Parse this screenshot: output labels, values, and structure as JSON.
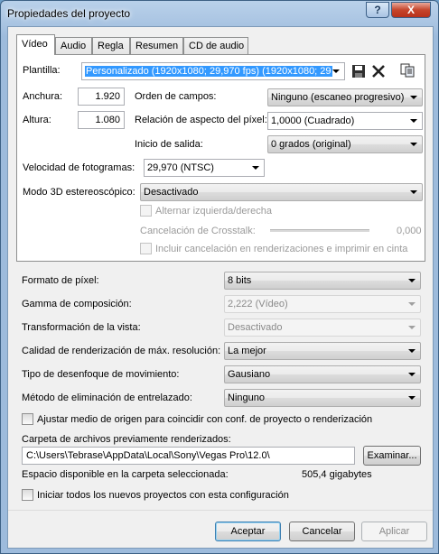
{
  "window": {
    "title": "Propiedades del proyecto",
    "help_label": "?",
    "close_label": "X"
  },
  "tabs": [
    {
      "label": "Vídeo",
      "active": true
    },
    {
      "label": "Audio"
    },
    {
      "label": "Regla"
    },
    {
      "label": "Resumen"
    },
    {
      "label": "CD de audio"
    }
  ],
  "video": {
    "template_label": "Plantilla:",
    "template_value": "Personalizado (1920x1080; 29,970 fps) (1920x1080; 29",
    "width_label": "Anchura:",
    "width_value": "1.920",
    "height_label": "Altura:",
    "height_value": "1.080",
    "field_order_label": "Orden de campos:",
    "field_order_value": "Ninguno (escaneo progresivo)",
    "pixel_aspect_label": "Relación de aspecto del píxel:",
    "pixel_aspect_value": "1,0000 (Cuadrado)",
    "output_rotation_label": "Inicio de salida:",
    "output_rotation_value": "0 grados (original)",
    "frame_rate_label": "Velocidad de fotogramas:",
    "frame_rate_value": "29,970 (NTSC)",
    "stereo3d_label": "Modo 3D estereoscópico:",
    "stereo3d_value": "Desactivado",
    "swap_lr_label": "Alternar izquierda/derecha",
    "crosstalk_label": "Cancelación de Crosstalk:",
    "crosstalk_value": "0,000",
    "include_crosstalk_label": "Incluir cancelación en renderizaciones e imprimir en cinta"
  },
  "settings": {
    "pixel_format_label": "Formato de píxel:",
    "pixel_format_value": "8 bits",
    "compositing_gamma_label": "Gamma de composición:",
    "compositing_gamma_value": "2,222 (Vídeo)",
    "view_transform_label": "Transformación de la vista:",
    "view_transform_value": "Desactivado",
    "render_quality_label": "Calidad de renderización de máx. resolución:",
    "render_quality_value": "La mejor",
    "motion_blur_label": "Tipo de desenfoque de movimiento:",
    "motion_blur_value": "Gausiano",
    "deinterlace_label": "Método de eliminación de entrelazado:",
    "deinterlace_value": "Ninguno",
    "adjust_source_label": "Ajustar medio de origen para coincidir con conf. de proyecto o renderización",
    "prerender_folder_label": "Carpeta de archivos previamente renderizados:",
    "prerender_folder_value": "C:\\Users\\Tebrase\\AppData\\Local\\Sony\\Vegas Pro\\12.0\\",
    "browse_label": "Examinar...",
    "free_space_label": "Espacio disponible en la carpeta seleccionada:",
    "free_space_value": "505,4 gigabytes",
    "start_new_label": "Iniciar todos los nuevos proyectos con esta configuración"
  },
  "buttons": {
    "ok": "Aceptar",
    "cancel": "Cancelar",
    "apply": "Aplicar"
  },
  "icons": [
    "save-icon",
    "delete-icon",
    "copy-properties-icon"
  ]
}
